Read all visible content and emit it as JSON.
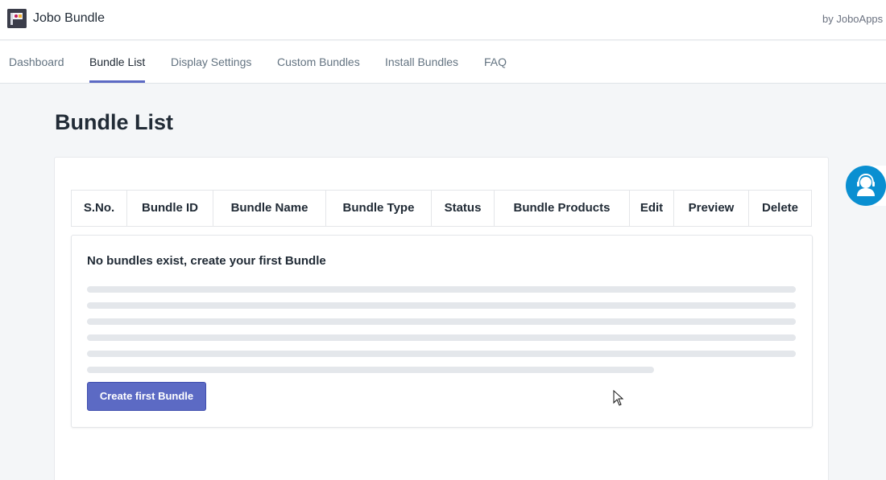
{
  "app": {
    "title": "Jobo Bundle",
    "by_line": "by JoboApps",
    "logo_icon": "app-logo-icon"
  },
  "nav": {
    "tabs": [
      {
        "label": "Dashboard",
        "active": false
      },
      {
        "label": "Bundle List",
        "active": true
      },
      {
        "label": "Display Settings",
        "active": false
      },
      {
        "label": "Custom Bundles",
        "active": false
      },
      {
        "label": "Install Bundles",
        "active": false
      },
      {
        "label": "FAQ",
        "active": false
      }
    ]
  },
  "page": {
    "title": "Bundle List"
  },
  "table": {
    "columns": [
      "S.No.",
      "Bundle ID",
      "Bundle Name",
      "Bundle Type",
      "Status",
      "Bundle Products",
      "Edit",
      "Preview",
      "Delete"
    ]
  },
  "empty_state": {
    "message": "No bundles exist, create your first Bundle",
    "button_label": "Create first Bundle"
  },
  "support": {
    "icon": "support-agent-icon"
  },
  "colors": {
    "accent": "#5c6ac4",
    "support": "#0a8fd1",
    "text": "#212b36",
    "muted": "#637381",
    "background": "#f4f6f8"
  }
}
